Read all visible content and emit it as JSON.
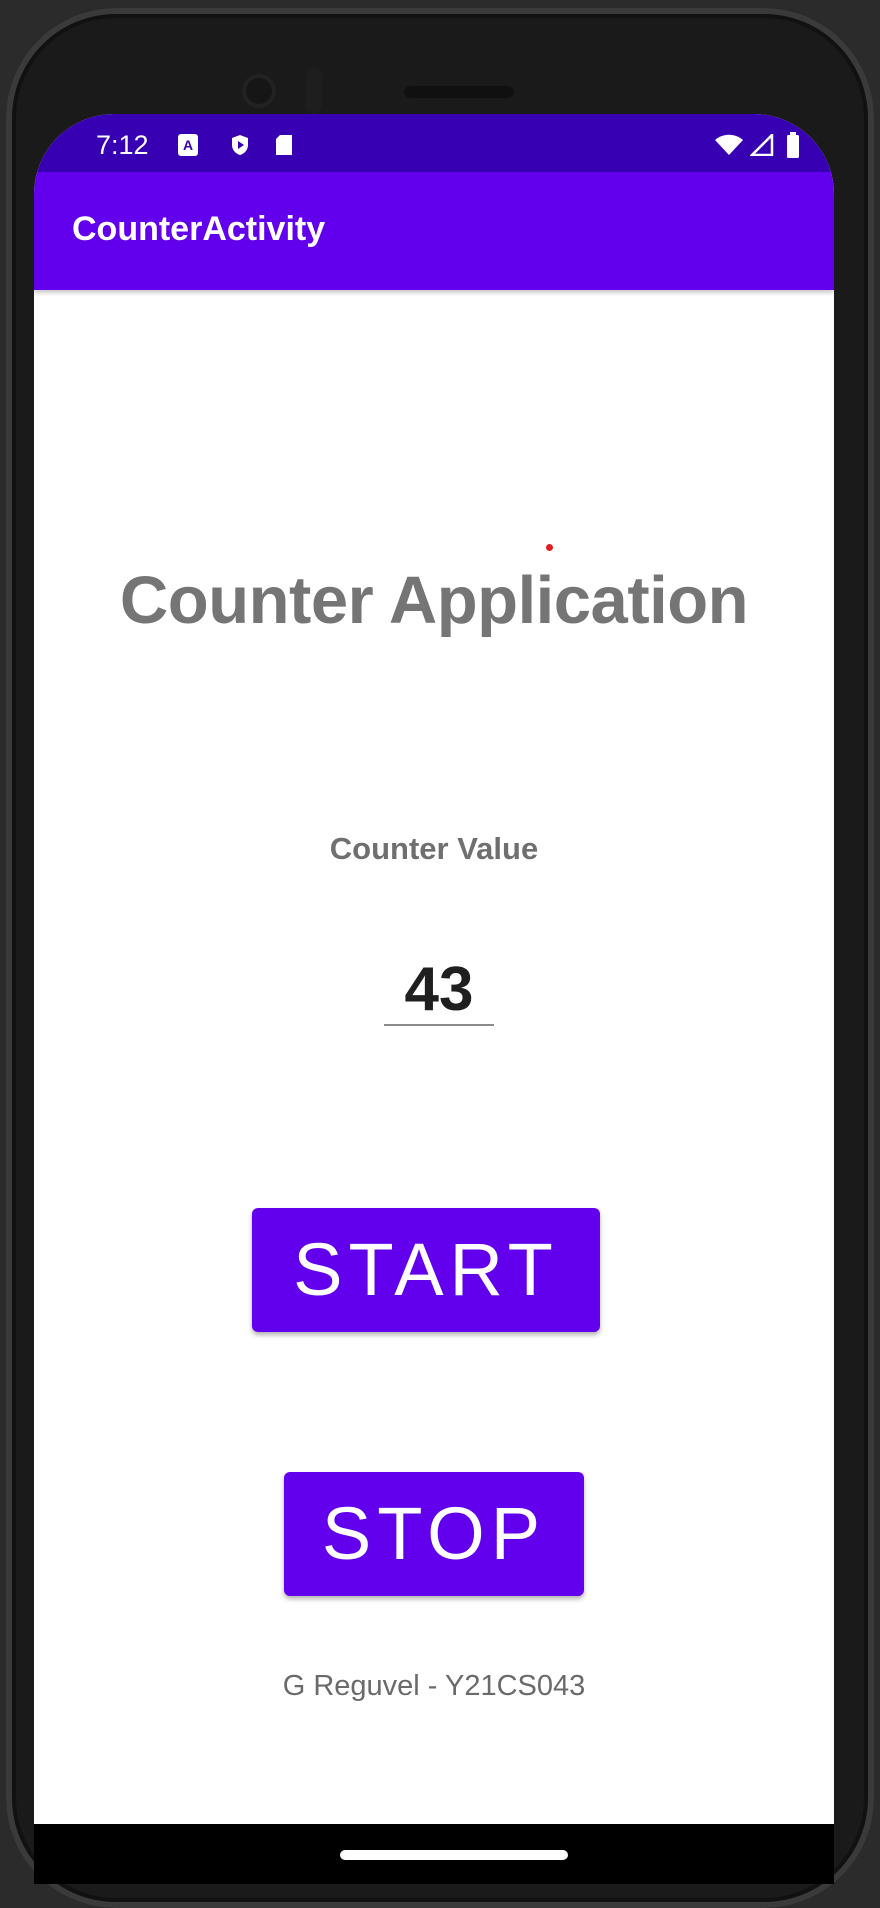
{
  "status_bar": {
    "time": "7:12",
    "icons": [
      "a-notification-icon",
      "shield-icon",
      "sd-card-icon",
      "wifi-icon",
      "signal-icon",
      "battery-icon"
    ]
  },
  "app_bar": {
    "title": "CounterActivity"
  },
  "main": {
    "heading": "Counter Application",
    "counter_label": "Counter Value",
    "counter_value": "43",
    "start_label": "START",
    "stop_label": "STOP",
    "footer": "G Reguvel - Y21CS043"
  },
  "colors": {
    "status_bar": "#3700b3",
    "app_bar": "#6200ee",
    "button": "#6200ee"
  }
}
